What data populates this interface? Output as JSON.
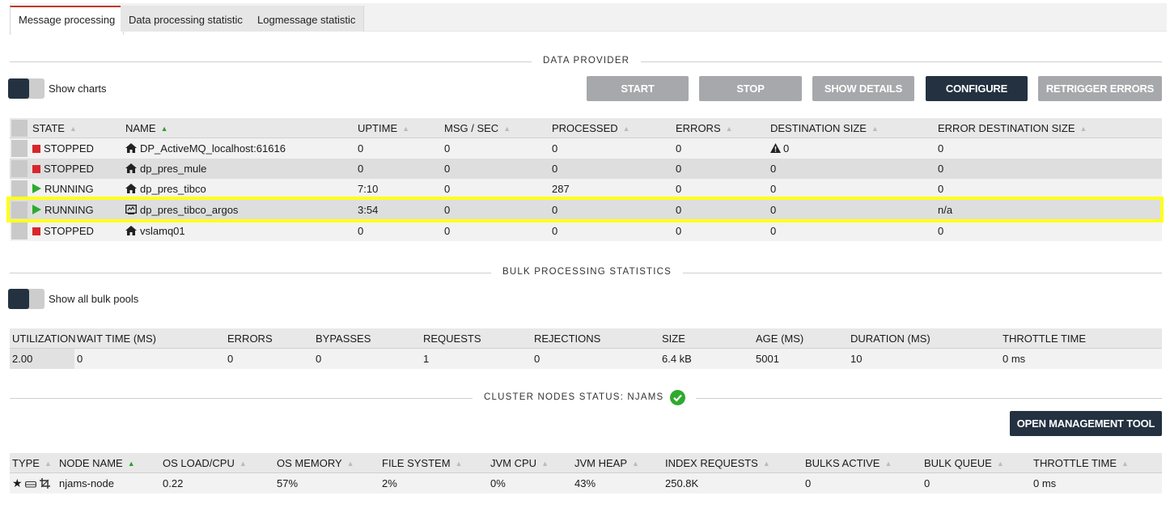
{
  "tabs": [
    {
      "label": "Message processing",
      "active": true
    },
    {
      "label": "Data processing statistic",
      "active": false
    },
    {
      "label": "Logmessage statistic",
      "active": false
    }
  ],
  "data_provider": {
    "title": "DATA PROVIDER",
    "show_charts_label": "Show charts",
    "buttons": {
      "start": "START",
      "stop": "STOP",
      "show_details": "SHOW DETAILS",
      "configure": "CONFIGURE",
      "retrigger": "RETRIGGER ERRORS"
    },
    "columns": [
      "STATE",
      "NAME",
      "UPTIME",
      "MSG / SEC",
      "PROCESSED",
      "ERRORS",
      "DESTINATION SIZE",
      "ERROR DESTINATION SIZE"
    ],
    "rows": [
      {
        "state": "STOPPED",
        "name": "DP_ActiveMQ_localhost:61616",
        "uptime": "0",
        "msg": "0",
        "processed": "0",
        "errors": "0",
        "dest": "0",
        "errdest": "0"
      },
      {
        "state": "STOPPED",
        "name": "dp_pres_mule",
        "uptime": "0",
        "msg": "0",
        "processed": "0",
        "errors": "0",
        "dest": "0",
        "errdest": "0"
      },
      {
        "state": "RUNNING",
        "name": "dp_pres_tibco",
        "uptime": "7:10",
        "msg": "0",
        "processed": "287",
        "errors": "0",
        "dest": "0",
        "errdest": "0"
      },
      {
        "state": "RUNNING",
        "name": "dp_pres_tibco_argos",
        "uptime": "3:54",
        "msg": "0",
        "processed": "0",
        "errors": "0",
        "dest": "0",
        "errdest": "n/a"
      },
      {
        "state": "STOPPED",
        "name": "vslamq01",
        "uptime": "0",
        "msg": "0",
        "processed": "0",
        "errors": "0",
        "dest": "0",
        "errdest": "0"
      }
    ]
  },
  "bulk": {
    "title": "BULK PROCESSING STATISTICS",
    "show_pools_label": "Show all bulk pools",
    "columns": [
      "UTILIZATION",
      "WAIT TIME (MS)",
      "ERRORS",
      "BYPASSES",
      "REQUESTS",
      "REJECTIONS",
      "SIZE",
      "AGE (MS)",
      "DURATION (MS)",
      "THROTTLE TIME"
    ],
    "values": [
      "2.00",
      "0",
      "0",
      "0",
      "1",
      "0",
      "6.4 kB",
      "5001",
      "10",
      "0 ms"
    ]
  },
  "cluster": {
    "title": "CLUSTER NODES STATUS: NJAMS",
    "open_tool": "OPEN MANAGEMENT TOOL",
    "columns": [
      "TYPE",
      "NODE NAME",
      "OS LOAD/CPU",
      "OS MEMORY",
      "FILE SYSTEM",
      "JVM CPU",
      "JVM HEAP",
      "INDEX REQUESTS",
      "BULKS ACTIVE",
      "BULK QUEUE",
      "THROTTLE TIME"
    ],
    "row": {
      "node_name": "njams-node",
      "os_load": "0.22",
      "os_memory": "57%",
      "file_system": "2%",
      "jvm_cpu": "0%",
      "jvm_heap": "43%",
      "index_requests": "250.8K",
      "bulks_active": "0",
      "bulk_queue": "0",
      "throttle": "0 ms"
    }
  },
  "colors": {
    "accent_dark": "#233140",
    "button_gray": "#a6a8ab",
    "running": "#2eaa2e",
    "stopped": "#d7262c",
    "highlight": "#ffff1a",
    "ok": "#2eaa2e"
  }
}
